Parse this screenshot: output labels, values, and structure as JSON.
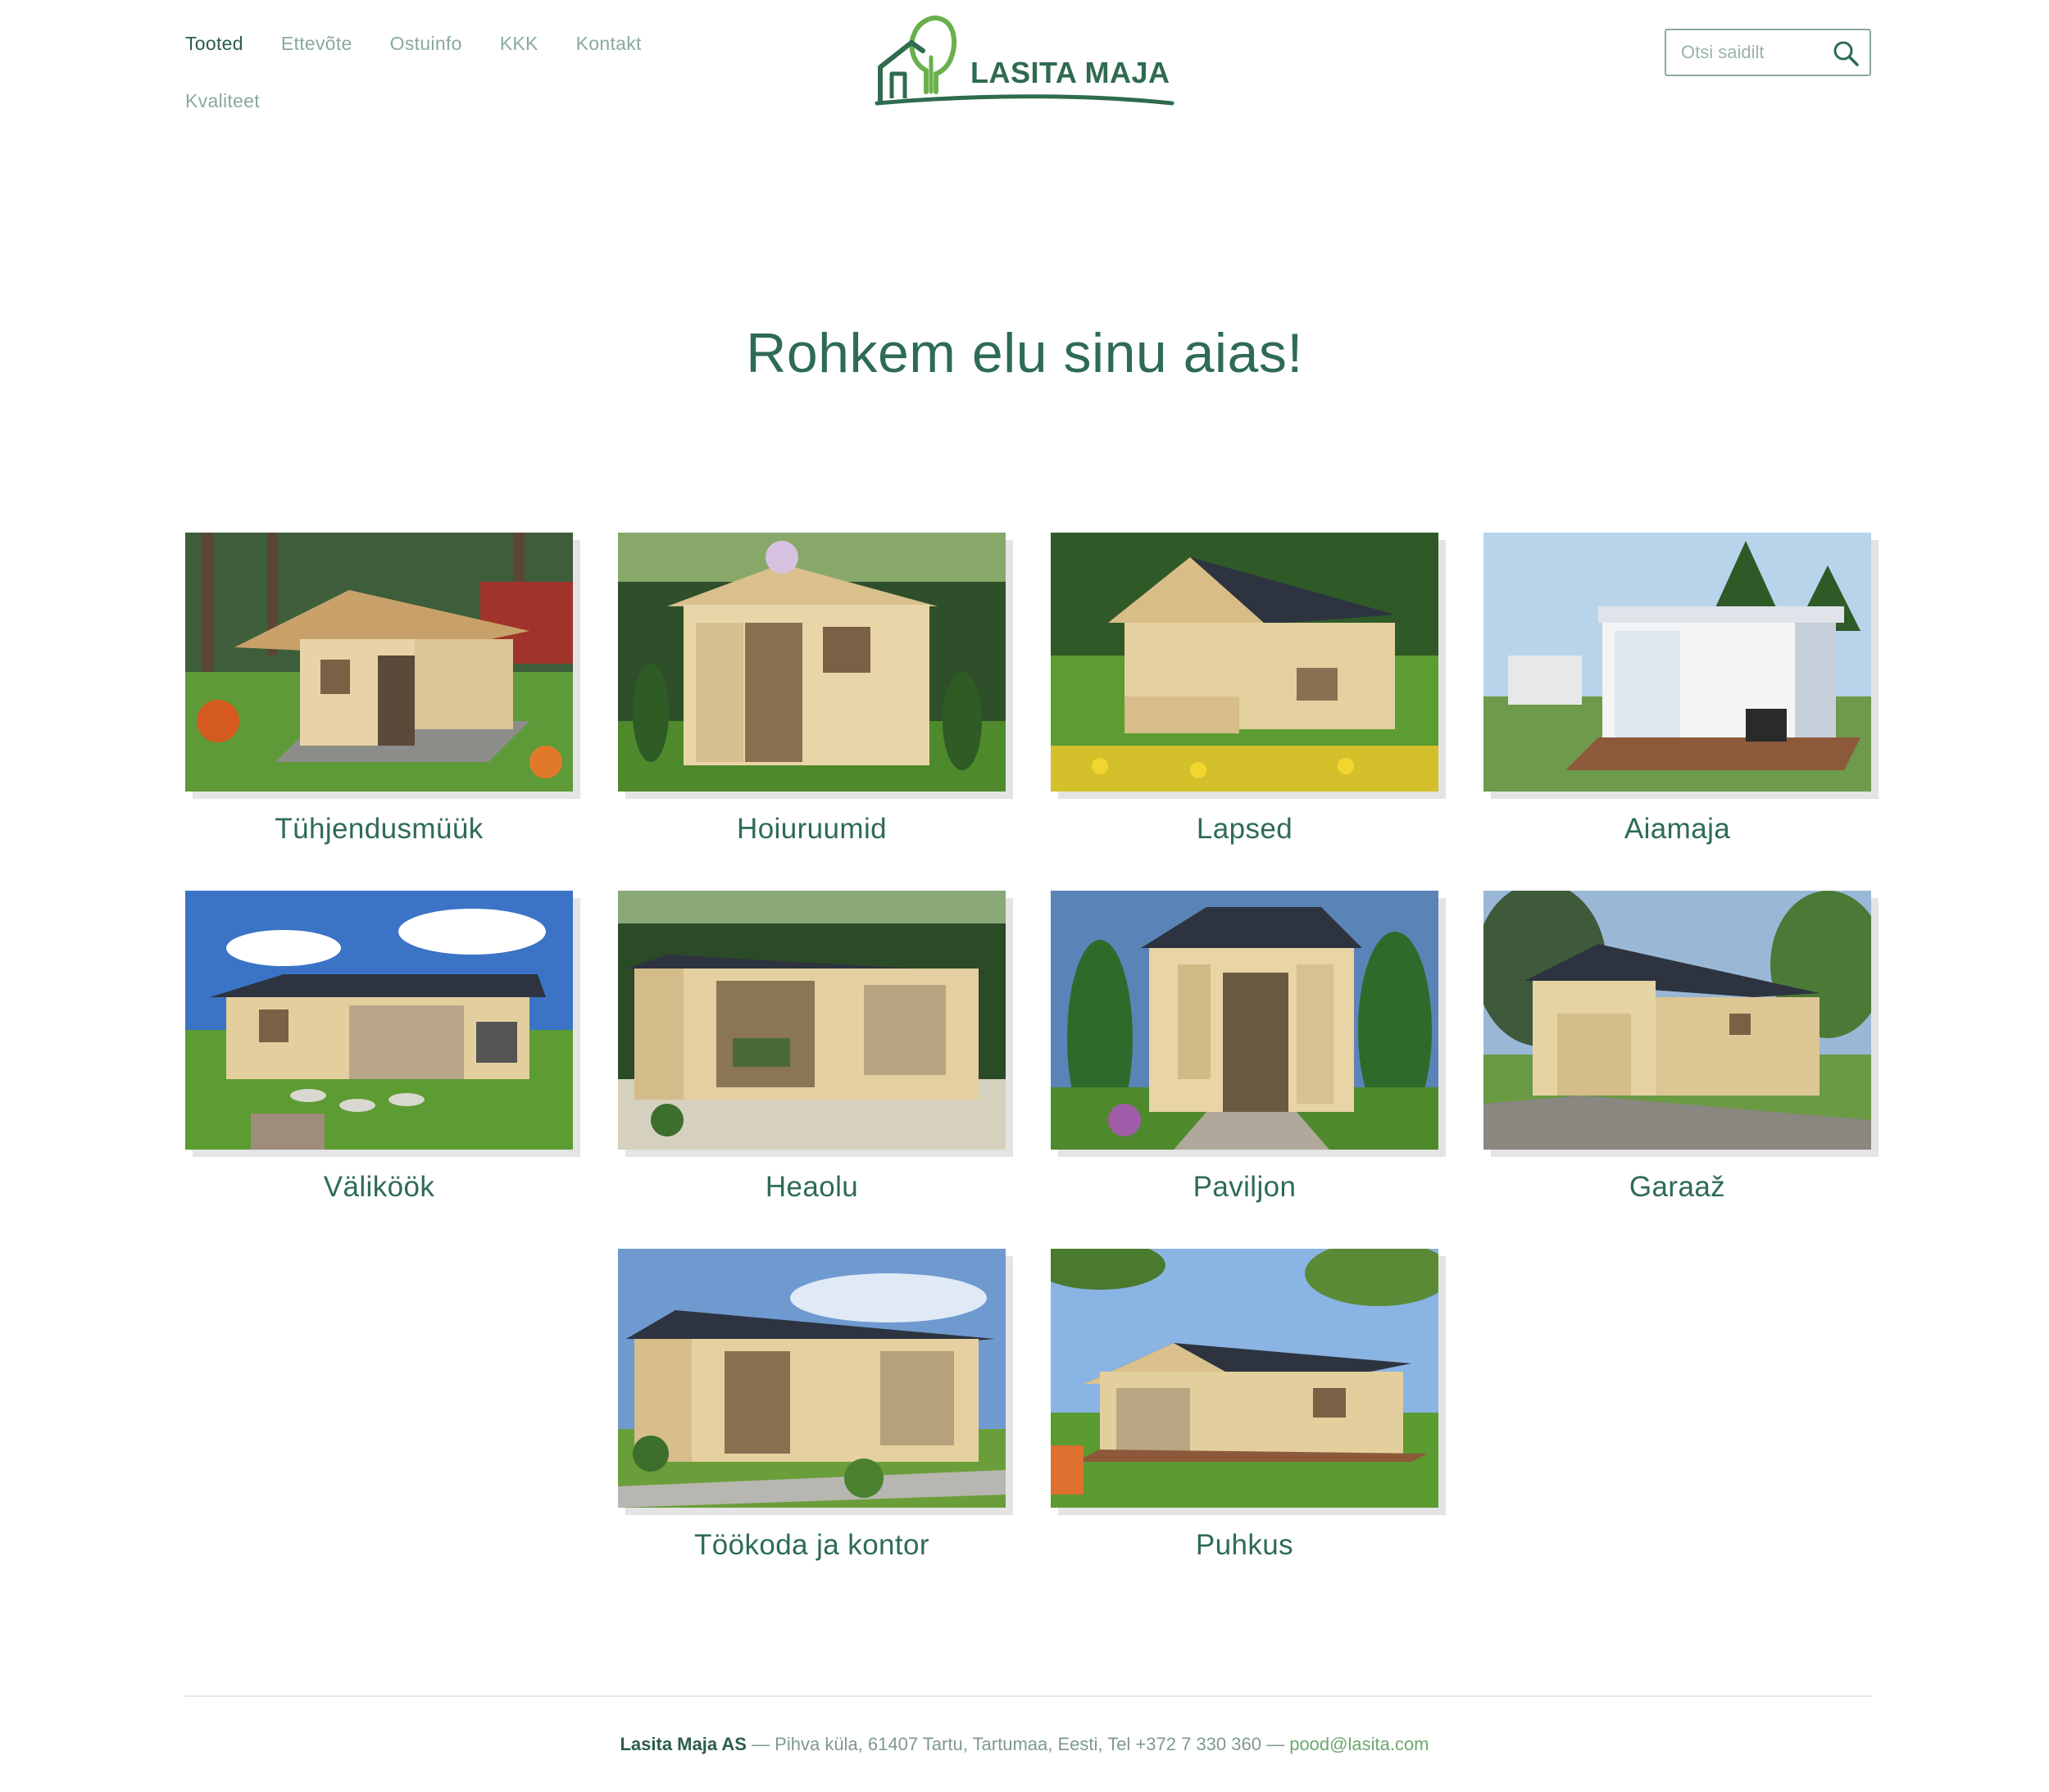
{
  "nav": {
    "items": [
      {
        "label": "Tooted",
        "active": true
      },
      {
        "label": "Ettevõte",
        "active": false
      },
      {
        "label": "Ostuinfo",
        "active": false
      },
      {
        "label": "KKK",
        "active": false
      },
      {
        "label": "Kontakt",
        "active": false
      },
      {
        "label": "Kvaliteet",
        "active": false
      }
    ]
  },
  "logo": {
    "text": "LASITA MAJA",
    "icon": "house-tree-logo"
  },
  "search": {
    "placeholder": "Otsi saidilt",
    "icon": "search-icon"
  },
  "hero": {
    "title": "Rohkem elu sinu aias!"
  },
  "categories": [
    {
      "label": "Tühjendusmüük",
      "icon": "cabin-photo"
    },
    {
      "label": "Hoiuruumid",
      "icon": "storage-shed-photo"
    },
    {
      "label": "Lapsed",
      "icon": "kids-playhouse-photo"
    },
    {
      "label": "Aiamaja",
      "icon": "garden-house-photo"
    },
    {
      "label": "Väliköök",
      "icon": "outdoor-kitchen-photo"
    },
    {
      "label": "Heaolu",
      "icon": "wellness-cabin-photo"
    },
    {
      "label": "Paviljon",
      "icon": "pavilion-photo"
    },
    {
      "label": "Garaaž",
      "icon": "garage-photo"
    },
    {
      "label": "Töökoda ja kontor",
      "icon": "workshop-office-photo"
    },
    {
      "label": "Puhkus",
      "icon": "holiday-house-photo"
    }
  ],
  "footer": {
    "company": "Lasita Maja AS",
    "address": " — Pihva küla, 61407 Tartu, Tartumaa, Eesti, Tel +372 7 330 360 — ",
    "email": "pood@lasita.com"
  },
  "colors": {
    "brand_green": "#2e6b55",
    "nav_muted": "#8aaa9c",
    "email_green": "#6ea86f",
    "logo_tree": "#6ab04c"
  }
}
